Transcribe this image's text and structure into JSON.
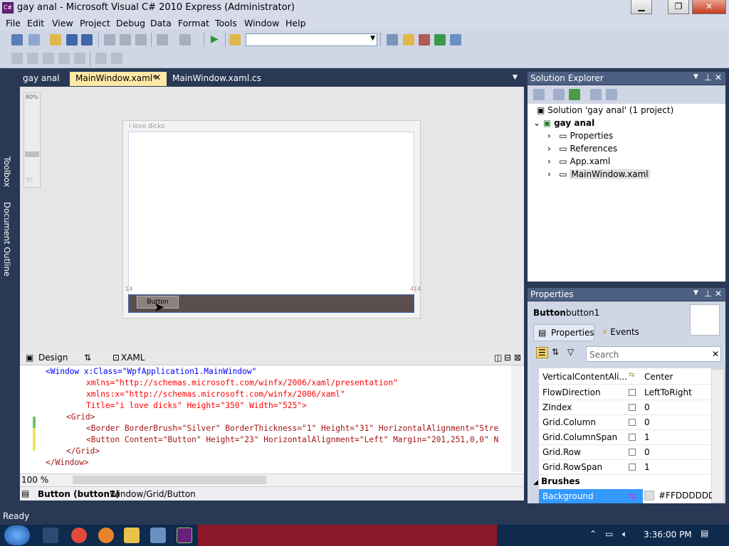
{
  "window": {
    "title": "gay anal - Microsoft Visual C# 2010 Express (Administrator)"
  },
  "menu": [
    "File",
    "Edit",
    "View",
    "Project",
    "Debug",
    "Data",
    "Format",
    "Tools",
    "Window",
    "Help"
  ],
  "left_strip": {
    "toolbox": "Toolbox",
    "document_outline": "Document Outline"
  },
  "tabs": {
    "project": "gay anal",
    "active": "MainWindow.xaml*",
    "code": "MainWindow.xaml.cs"
  },
  "designer": {
    "zoom": "80%",
    "window_title": "i love dicks",
    "left_margin": "14",
    "right_margin": "414",
    "button_label": "Button"
  },
  "view_tabs": {
    "design": "Design",
    "xaml": "XAML"
  },
  "xaml_lines": [
    "<Window x:Class=\"WpfApplication1.MainWindow\"",
    "xmlns=\"http://schemas.microsoft.com/winfx/2006/xaml/presentation\"",
    "xmlns:x=\"http://schemas.microsoft.com/winfx/2006/xaml\"",
    "Title=\"i love dicks\" Height=\"350\" Width=\"525\">",
    "<Grid>",
    "<Border BorderBrush=\"Silver\" BorderThickness=\"1\" Height=\"31\" HorizontalAlignment=\"Stre",
    "<Button Content=\"Button\" Height=\"23\" HorizontalAlignment=\"Left\" Margin=\"201,251,0,0\" N",
    "</Grid>",
    "</Window>"
  ],
  "editor_zoom": "100 %",
  "breadcrumb": {
    "element": "Button (button1)",
    "path": "Window/Grid/Button"
  },
  "solution_explorer": {
    "title": "Solution Explorer",
    "solution": "Solution 'gay anal' (1 project)",
    "project": "gay anal",
    "items": [
      "Properties",
      "References",
      "App.xaml",
      "MainWindow.xaml"
    ]
  },
  "properties": {
    "title": "Properties",
    "type": "Button",
    "name": "button1",
    "tab_properties": "Properties",
    "tab_events": "Events",
    "search_placeholder": "Search",
    "rows": [
      {
        "name": "VerticalContentAli...",
        "value": "Center"
      },
      {
        "name": "FlowDirection",
        "value": "LeftToRight"
      },
      {
        "name": "ZIndex",
        "value": "0"
      },
      {
        "name": "Grid.Column",
        "value": "0"
      },
      {
        "name": "Grid.ColumnSpan",
        "value": "1"
      },
      {
        "name": "Grid.Row",
        "value": "0"
      },
      {
        "name": "Grid.RowSpan",
        "value": "1"
      }
    ],
    "category": "Brushes",
    "selected_row": {
      "name": "Background",
      "value": "#FFDDDDDD"
    }
  },
  "status": "Ready",
  "clock": "3:36:00 PM",
  "colors": {
    "title_bg": "#d6dbe9",
    "ide_bg": "#293955",
    "panel_title": "#4d6082",
    "active_tab": "#ffe8a6",
    "selection": "#3399ff"
  }
}
